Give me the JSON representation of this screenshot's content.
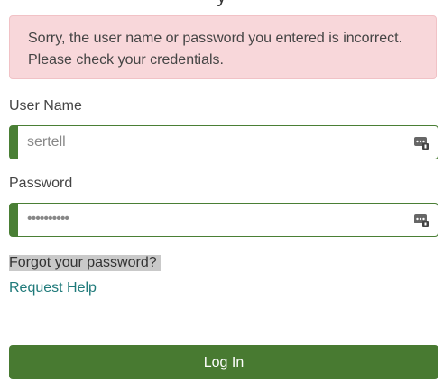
{
  "header": {
    "title_fragment": "y"
  },
  "alert": {
    "line1": "Sorry, the user name or password you entered is incorrect.",
    "line2": "Please check your credentials."
  },
  "username": {
    "label": "User Name",
    "value": "sertell",
    "icon": "credential-key-icon"
  },
  "password": {
    "label": "Password",
    "masked_value": "••••••••••",
    "icon": "credential-key-icon"
  },
  "links": {
    "forgot": "Forgot your password?",
    "request_help": "Request Help"
  },
  "login_button": {
    "label": "Log In"
  },
  "colors": {
    "accent": "#487a31",
    "alert_bg": "#f8d7da",
    "link": "#1f7a7a"
  }
}
